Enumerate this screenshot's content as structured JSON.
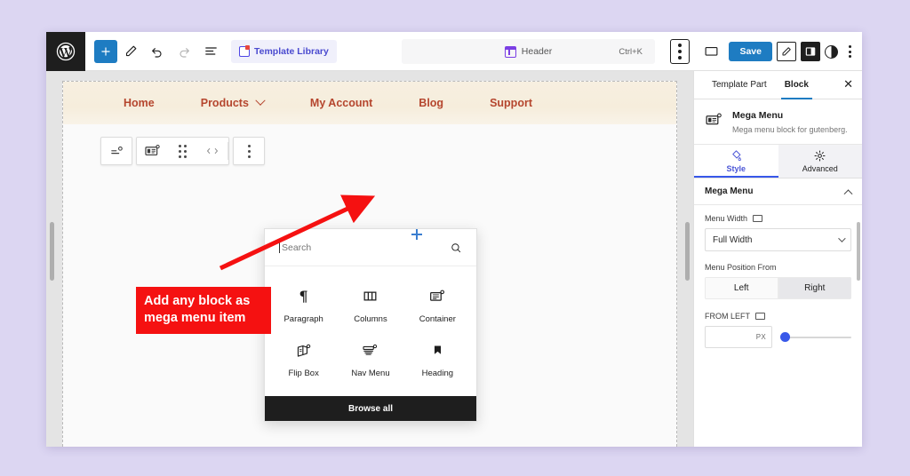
{
  "topbar": {
    "logo_icon": "wordpress-logo-icon",
    "add_block_label": "+",
    "icons": [
      "add-block-icon",
      "edit-pencil-icon",
      "undo-icon",
      "redo-icon",
      "list-view-icon"
    ],
    "template_library_label": "Template Library",
    "document_title": "Header",
    "document_shortcut": "Ctrl+K",
    "save_label": "Save",
    "right_icons": [
      "view-desktop-icon",
      "save-button",
      "settings-pencil-icon",
      "sidebar-toggle-icon",
      "contrast-icon",
      "options-kebab-icon"
    ]
  },
  "canvas": {
    "nav_items": [
      {
        "label": "Home",
        "has_chevron": false
      },
      {
        "label": "Products",
        "has_chevron": true
      },
      {
        "label": "My Account",
        "has_chevron": false
      },
      {
        "label": "Blog",
        "has_chevron": false
      },
      {
        "label": "Support",
        "has_chevron": false
      }
    ],
    "block_toolbar": {
      "parent_select_icon": "select-parent-mega-menu-icon",
      "block_icon": "mega-menu-icon",
      "drag_icon": "drag-handle-icon",
      "move_icon": "move-arrows-icon",
      "options_icon": "block-options-kebab-icon"
    },
    "callout": {
      "line1": "Add any block as",
      "line2": "mega menu item",
      "color": "#f51111"
    },
    "inserter_plus": "+"
  },
  "inserter": {
    "search_placeholder": "Search",
    "search_value": "",
    "search_icon": "search-icon",
    "blocks": [
      {
        "label": "Paragraph",
        "icon": "paragraph-pilcrow-icon"
      },
      {
        "label": "Columns",
        "icon": "columns-icon"
      },
      {
        "label": "Container",
        "icon": "container-icon"
      },
      {
        "label": "Flip Box",
        "icon": "flip-box-icon"
      },
      {
        "label": "Nav Menu",
        "icon": "nav-menu-icon"
      },
      {
        "label": "Heading",
        "icon": "heading-bookmark-icon"
      }
    ],
    "browse_all_label": "Browse all"
  },
  "sidebar": {
    "tabs": [
      {
        "label": "Template Part",
        "active": false
      },
      {
        "label": "Block",
        "active": true
      }
    ],
    "close_label": "✕",
    "block": {
      "icon": "mega-menu-icon",
      "name": "Mega Menu",
      "description": "Mega menu block for gutenberg."
    },
    "segments": [
      {
        "label": "Style",
        "icon": "style-paint-icon",
        "active": true
      },
      {
        "label": "Advanced",
        "icon": "gear-icon",
        "active": false
      }
    ],
    "panel": {
      "title": "Mega Menu",
      "collapse_icon": "chevron-up-icon",
      "controls": {
        "menu_width_label": "Menu Width",
        "menu_width_device_icon": "desktop-icon",
        "menu_width_value": "Full Width",
        "menu_position_label": "Menu Position From",
        "menu_position_options": [
          {
            "label": "Left",
            "selected": false
          },
          {
            "label": "Right",
            "selected": true
          }
        ],
        "from_left_label": "FROM LEFT",
        "from_left_device_icon": "desktop-icon",
        "from_left_unit": "PX",
        "from_left_value": "",
        "slider_fill_color": "#3858e9"
      }
    }
  }
}
